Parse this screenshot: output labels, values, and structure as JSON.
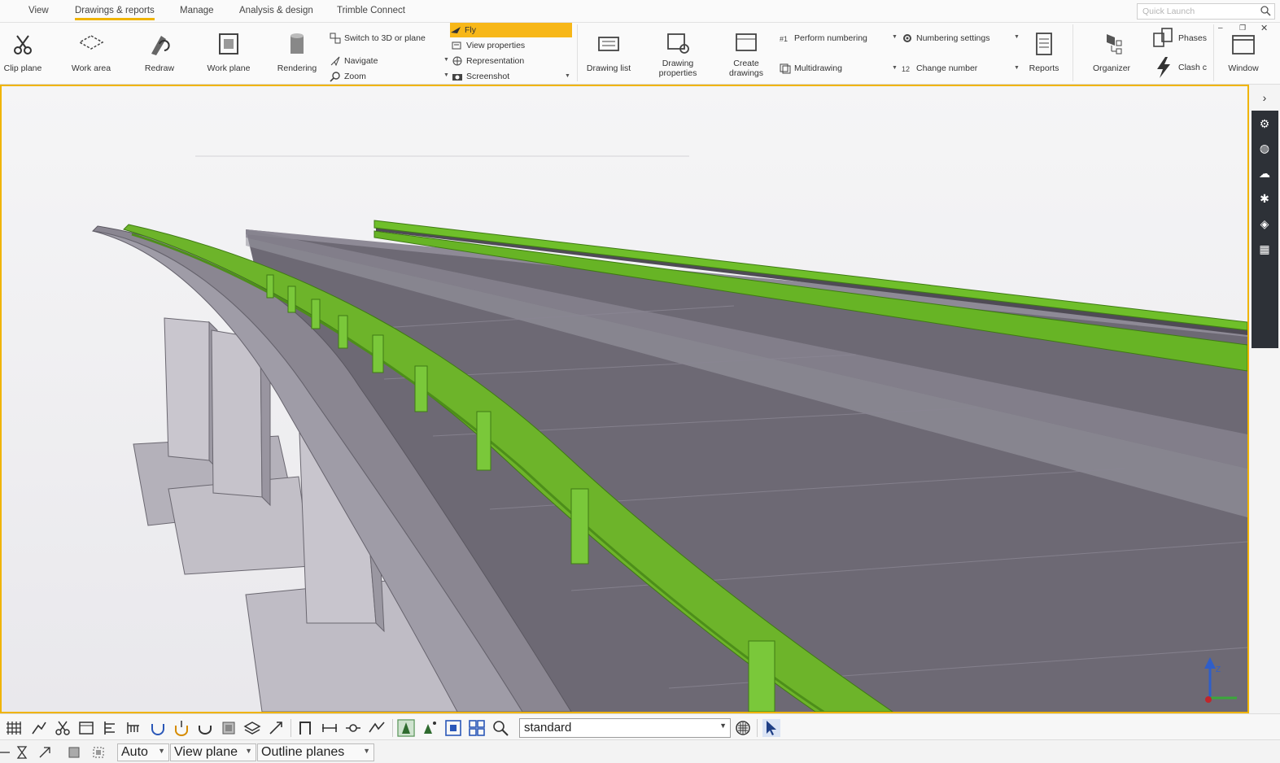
{
  "menu": {
    "tabs": [
      "View",
      "Drawings & reports",
      "Manage",
      "Analysis & design",
      "Trimble Connect"
    ],
    "active_tab": "Drawings & reports",
    "quick_launch_placeholder": "Quick Launch"
  },
  "ribbon": {
    "clip_plane": "Clip plane",
    "work_area": "Work area",
    "redraw": "Redraw",
    "work_plane": "Work plane",
    "rendering": "Rendering",
    "switch_3d": "Switch to 3D or plane",
    "navigate": "Navigate",
    "zoom": "Zoom",
    "fly": "Fly",
    "view_properties": "View properties",
    "representation": "Representation",
    "screenshot": "Screenshot",
    "drawing_list": "Drawing list",
    "drawing_properties": "Drawing properties",
    "create_drawings": "Create drawings",
    "perform_numbering": "Perform numbering",
    "multidrawing": "Multidrawing",
    "numbering_settings": "Numbering settings",
    "change_number": "Change number",
    "reports": "Reports",
    "organizer": "Organizer",
    "phases": "Phases",
    "clash": "Clash c",
    "window": "Window"
  },
  "toolbar": {
    "view_filter_value": "standard"
  },
  "status": {
    "snap_mode": "Auto",
    "plane": "View plane",
    "outline": "Outline planes"
  },
  "colors": {
    "accent": "#f0b400",
    "railing": "#6fbf2a",
    "deck": "#6f6b76",
    "concrete": "#b7b4bd"
  }
}
